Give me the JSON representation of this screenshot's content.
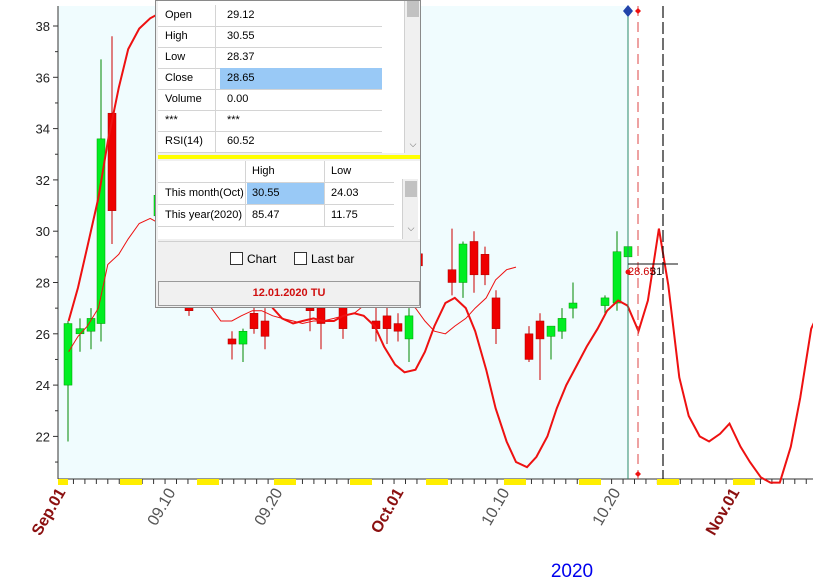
{
  "chart_data": {
    "type": "candlestick",
    "y_ticks": [
      "38",
      "36",
      "34",
      "32",
      "30",
      "28",
      "26",
      "24",
      "22"
    ],
    "x_labels": [
      {
        "label": "Sep.01",
        "month": true
      },
      {
        "label": "09.10",
        "month": false
      },
      {
        "label": "09.20",
        "month": false
      },
      {
        "label": "Oct.01",
        "month": true
      },
      {
        "label": "10.10",
        "month": false
      },
      {
        "label": "10.20",
        "month": false
      },
      {
        "label": "Nov.01",
        "month": true
      }
    ],
    "year_label": "2020",
    "ylim": [
      20.3,
      38.8
    ],
    "price_marker_text": "28.65",
    "price_marker_text_overlay": "31",
    "candles": [
      {
        "open": 24.0,
        "high": 26.5,
        "low": 21.8,
        "close": 26.4
      },
      {
        "open": 26.0,
        "high": 26.6,
        "low": 25.3,
        "close": 26.2
      },
      {
        "open": 26.1,
        "high": 27.0,
        "low": 25.4,
        "close": 26.6
      },
      {
        "open": 26.4,
        "high": 36.7,
        "low": 25.7,
        "close": 33.6
      },
      {
        "open": 34.6,
        "high": 37.6,
        "low": 29.5,
        "close": 30.8
      },
      {
        "open": 30.6,
        "high": 31.3,
        "low": 30.2,
        "close": 31.4
      },
      {
        "open": 27.1,
        "high": 27.4,
        "low": 26.7,
        "close": 26.9
      },
      {
        "open": 25.8,
        "high": 26.1,
        "low": 25.0,
        "close": 25.6
      },
      {
        "open": 25.6,
        "high": 26.2,
        "low": 24.9,
        "close": 26.1
      },
      {
        "open": 26.8,
        "high": 27.5,
        "low": 26.0,
        "close": 26.2
      },
      {
        "open": 26.5,
        "high": 27.0,
        "low": 25.4,
        "close": 25.9
      },
      {
        "open": 27.0,
        "high": 27.6,
        "low": 26.1,
        "close": 26.9
      },
      {
        "open": 27.0,
        "high": 27.6,
        "low": 25.4,
        "close": 26.4
      },
      {
        "open": 27.1,
        "high": 27.6,
        "low": 25.8,
        "close": 26.2
      },
      {
        "open": 26.5,
        "high": 27.5,
        "low": 25.7,
        "close": 26.2
      },
      {
        "open": 26.7,
        "high": 27.2,
        "low": 25.6,
        "close": 26.2
      },
      {
        "open": 26.4,
        "high": 26.8,
        "low": 25.7,
        "close": 26.1
      },
      {
        "open": 25.8,
        "high": 27.0,
        "low": 24.9,
        "close": 26.7
      },
      {
        "open": 28.5,
        "high": 30.1,
        "low": 27.5,
        "close": 28.0
      },
      {
        "open": 28.0,
        "high": 29.6,
        "low": 27.4,
        "close": 29.5
      },
      {
        "open": 29.6,
        "high": 30.0,
        "low": 27.6,
        "close": 28.3
      },
      {
        "open": 29.1,
        "high": 29.4,
        "low": 27.9,
        "close": 28.3
      },
      {
        "open": 27.4,
        "high": 27.7,
        "low": 25.6,
        "close": 26.2
      },
      {
        "open": 26.0,
        "high": 26.3,
        "low": 24.9,
        "close": 25.0
      },
      {
        "open": 26.5,
        "high": 26.8,
        "low": 24.2,
        "close": 25.8
      },
      {
        "open": 25.9,
        "high": 26.2,
        "low": 25.0,
        "close": 26.3
      },
      {
        "open": 26.1,
        "high": 27.0,
        "low": 25.8,
        "close": 26.6
      },
      {
        "open": 27.0,
        "high": 28.0,
        "low": 26.6,
        "close": 27.2
      },
      {
        "open": 27.1,
        "high": 27.5,
        "low": 26.7,
        "close": 27.4
      },
      {
        "open": 27.2,
        "high": 30.0,
        "low": 26.9,
        "close": 29.2
      },
      {
        "open": 29.0,
        "high": 29.9,
        "low": 28.7,
        "close": 29.4
      },
      {
        "open": 29.12,
        "high": 30.55,
        "low": 28.37,
        "close": 28.65
      }
    ],
    "series": [
      {
        "name": "",
        "color": "#ee1111",
        "points": [
          [
            8,
            26.5
          ],
          [
            14,
            27.8
          ],
          [
            20,
            29.4
          ],
          [
            27,
            31.3
          ],
          [
            33,
            33.5
          ],
          [
            40,
            35.6
          ],
          [
            46,
            37.1
          ],
          [
            53,
            37.9
          ],
          [
            60,
            38.3
          ],
          [
            66,
            38.5
          ],
          [
            73,
            38.5
          ],
          [
            79,
            38.2
          ],
          [
            86,
            37.3
          ],
          [
            92,
            36.4
          ],
          [
            99,
            35.1
          ],
          [
            105,
            33.7
          ],
          [
            112,
            32.2
          ],
          [
            118,
            30.5
          ],
          [
            125,
            29.0
          ],
          [
            131,
            27.8
          ],
          [
            138,
            27.0
          ],
          [
            144,
            26.6
          ],
          [
            151,
            26.4
          ],
          [
            157,
            26.5
          ],
          [
            164,
            26.6
          ],
          [
            170,
            26.5
          ],
          [
            177,
            26.5
          ],
          [
            183,
            26.7
          ],
          [
            190,
            26.8
          ],
          [
            196,
            26.7
          ],
          [
            203,
            26.3
          ],
          [
            209,
            25.5
          ],
          [
            216,
            24.8
          ],
          [
            222,
            24.5
          ],
          [
            229,
            24.6
          ],
          [
            235,
            25.3
          ],
          [
            241,
            26.3
          ],
          [
            248,
            27.2
          ],
          [
            254,
            27.4
          ],
          [
            261,
            27.0
          ],
          [
            267,
            26.1
          ],
          [
            274,
            24.6
          ],
          [
            280,
            23.1
          ],
          [
            287,
            21.8
          ],
          [
            293,
            21.0
          ],
          [
            300,
            20.8
          ],
          [
            306,
            21.2
          ],
          [
            313,
            22.0
          ],
          [
            319,
            23.1
          ],
          [
            325,
            24.0
          ],
          [
            332,
            24.8
          ],
          [
            338,
            25.5
          ],
          [
            345,
            26.2
          ],
          [
            351,
            26.9
          ],
          [
            358,
            27.3
          ],
          [
            364,
            27.1
          ],
          [
            371,
            26.1
          ],
          [
            377,
            27.3
          ],
          [
            384,
            30.1
          ],
          [
            390,
            27.9
          ],
          [
            397,
            24.3
          ],
          [
            403,
            22.8
          ],
          [
            410,
            22.0
          ],
          [
            416,
            21.8
          ],
          [
            423,
            22.1
          ],
          [
            429,
            22.5
          ],
          [
            436,
            21.6
          ],
          [
            442,
            21.0
          ],
          [
            449,
            20.4
          ],
          [
            455,
            20.2
          ],
          [
            461,
            20.2
          ],
          [
            468,
            21.6
          ],
          [
            474,
            23.5
          ],
          [
            481,
            26.2
          ],
          [
            487,
            27.0
          ]
        ]
      },
      {
        "name": "",
        "color": "#ee1111",
        "thin": true,
        "points": [
          [
            8,
            25.3
          ],
          [
            14,
            25.9
          ],
          [
            20,
            26.3
          ],
          [
            27,
            27.0
          ],
          [
            33,
            28.7
          ],
          [
            40,
            29.1
          ],
          [
            46,
            29.7
          ],
          [
            53,
            30.3
          ],
          [
            60,
            30.5
          ],
          [
            66,
            30.3
          ],
          [
            73,
            30.0
          ],
          [
            79,
            29.6
          ],
          [
            86,
            28.7
          ],
          [
            92,
            27.6
          ],
          [
            99,
            27.0
          ],
          [
            105,
            26.5
          ],
          [
            112,
            26.5
          ],
          [
            118,
            26.7
          ],
          [
            125,
            26.9
          ],
          [
            131,
            26.9
          ],
          [
            138,
            26.7
          ],
          [
            144,
            26.6
          ],
          [
            151,
            26.5
          ],
          [
            157,
            26.4
          ],
          [
            164,
            26.5
          ],
          [
            170,
            26.5
          ],
          [
            177,
            26.6
          ],
          [
            183,
            26.7
          ],
          [
            190,
            26.8
          ],
          [
            196,
            27.1
          ],
          [
            203,
            27.5
          ],
          [
            209,
            27.8
          ],
          [
            216,
            27.7
          ],
          [
            222,
            27.4
          ],
          [
            229,
            27.0
          ],
          [
            235,
            26.5
          ],
          [
            241,
            26.1
          ],
          [
            248,
            26.0
          ],
          [
            254,
            26.3
          ],
          [
            261,
            26.6
          ],
          [
            267,
            27.0
          ],
          [
            274,
            27.4
          ],
          [
            280,
            28.1
          ],
          [
            287,
            28.5
          ],
          [
            293,
            28.6
          ]
        ]
      }
    ]
  },
  "info_panel": {
    "rows": [
      {
        "key": "Open",
        "value": "29.12"
      },
      {
        "key": "High",
        "value": "30.55"
      },
      {
        "key": "Low",
        "value": "28.37"
      },
      {
        "key": "Close",
        "value": "28.65"
      },
      {
        "key": "Volume",
        "value": "0.00"
      },
      {
        "key": "***",
        "value": "***"
      },
      {
        "key": "RSI(14)",
        "value": "60.52"
      }
    ],
    "range_table": {
      "headers": [
        "",
        "High",
        "Low"
      ],
      "rows": [
        {
          "label": "This month(Oct)",
          "high": "30.55",
          "low": "24.03"
        },
        {
          "label": "This year(2020)",
          "high": "85.47",
          "low": "11.75"
        }
      ]
    },
    "chart_checkbox_label": "Chart",
    "last_bar_checkbox_label": "Last bar",
    "current_date": "12.01.2020 TU"
  },
  "colors": {
    "plot_bg": "#f0fcfe",
    "up_candle": "#00ee22",
    "down_candle": "#ee0000",
    "axis_label_month": "#8b1010",
    "axis_label_day": "#555555",
    "year_label": "#0000ee",
    "highlight_row": "#99c9f6",
    "weekend_mark": "#ffee00"
  }
}
